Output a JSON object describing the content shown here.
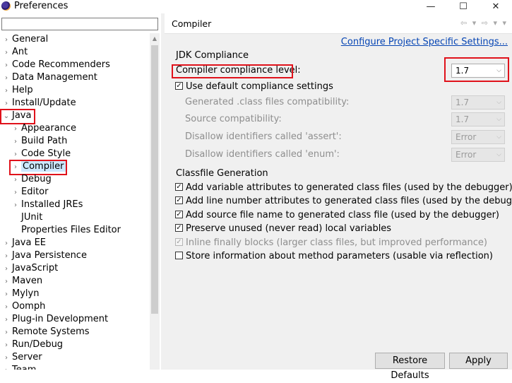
{
  "window": {
    "title": "Preferences",
    "minimize": "—",
    "maximize": "☐",
    "close": "✕"
  },
  "filter": {
    "placeholder": "",
    "value": ""
  },
  "tree": {
    "items": [
      {
        "label": "General",
        "expandable": true,
        "expanded": false,
        "depth": 0
      },
      {
        "label": "Ant",
        "expandable": true,
        "expanded": false,
        "depth": 0
      },
      {
        "label": "Code Recommenders",
        "expandable": true,
        "expanded": false,
        "depth": 0
      },
      {
        "label": "Data Management",
        "expandable": true,
        "expanded": false,
        "depth": 0
      },
      {
        "label": "Help",
        "expandable": true,
        "expanded": false,
        "depth": 0
      },
      {
        "label": "Install/Update",
        "expandable": true,
        "expanded": false,
        "depth": 0
      },
      {
        "label": "Java",
        "expandable": true,
        "expanded": true,
        "depth": 0,
        "highlighted": true
      },
      {
        "label": "Appearance",
        "expandable": true,
        "expanded": false,
        "depth": 1
      },
      {
        "label": "Build Path",
        "expandable": true,
        "expanded": false,
        "depth": 1
      },
      {
        "label": "Code Style",
        "expandable": true,
        "expanded": false,
        "depth": 1
      },
      {
        "label": "Compiler",
        "expandable": true,
        "expanded": false,
        "depth": 1,
        "selected": true,
        "highlighted": true
      },
      {
        "label": "Debug",
        "expandable": true,
        "expanded": false,
        "depth": 1
      },
      {
        "label": "Editor",
        "expandable": true,
        "expanded": false,
        "depth": 1
      },
      {
        "label": "Installed JREs",
        "expandable": true,
        "expanded": false,
        "depth": 1
      },
      {
        "label": "JUnit",
        "expandable": false,
        "expanded": false,
        "depth": 1
      },
      {
        "label": "Properties Files Editor",
        "expandable": false,
        "expanded": false,
        "depth": 1
      },
      {
        "label": "Java EE",
        "expandable": true,
        "expanded": false,
        "depth": 0
      },
      {
        "label": "Java Persistence",
        "expandable": true,
        "expanded": false,
        "depth": 0
      },
      {
        "label": "JavaScript",
        "expandable": true,
        "expanded": false,
        "depth": 0
      },
      {
        "label": "Maven",
        "expandable": true,
        "expanded": false,
        "depth": 0
      },
      {
        "label": "Mylyn",
        "expandable": true,
        "expanded": false,
        "depth": 0
      },
      {
        "label": "Oomph",
        "expandable": true,
        "expanded": false,
        "depth": 0
      },
      {
        "label": "Plug-in Development",
        "expandable": true,
        "expanded": false,
        "depth": 0
      },
      {
        "label": "Remote Systems",
        "expandable": true,
        "expanded": false,
        "depth": 0
      },
      {
        "label": "Run/Debug",
        "expandable": true,
        "expanded": false,
        "depth": 0
      },
      {
        "label": "Server",
        "expandable": true,
        "expanded": false,
        "depth": 0
      },
      {
        "label": "Team",
        "expandable": true,
        "expanded": false,
        "depth": 0
      }
    ]
  },
  "page": {
    "title": "Compiler",
    "nav_arrows": "⇦ ▾ ⇨ ▾ ▾",
    "config_link": "Configure Project Specific Settings...",
    "jdk_section": {
      "title": "JDK Compliance",
      "compliance_label": "Compiler compliance level:",
      "compliance_value": "1.7",
      "use_default_label": "Use default compliance settings",
      "use_default_checked": true,
      "rows": [
        {
          "label": "Generated .class files compatibility:",
          "value": "1.7"
        },
        {
          "label": "Source compatibility:",
          "value": "1.7"
        },
        {
          "label": "Disallow identifiers called 'assert':",
          "value": "Error"
        },
        {
          "label": "Disallow identifiers called 'enum':",
          "value": "Error"
        }
      ]
    },
    "classfile_section": {
      "title": "Classfile Generation",
      "options": [
        {
          "label": "Add variable attributes to generated class files (used by the debugger)",
          "checked": true,
          "enabled": true
        },
        {
          "label": "Add line number attributes to generated class files (used by the debugger)",
          "checked": true,
          "enabled": true
        },
        {
          "label": "Add source file name to generated class file (used by the debugger)",
          "checked": true,
          "enabled": true
        },
        {
          "label": "Preserve unused (never read) local variables",
          "checked": true,
          "enabled": true
        },
        {
          "label": "Inline finally blocks (larger class files, but improved performance)",
          "checked": true,
          "enabled": false
        },
        {
          "label": "Store information about method parameters (usable via reflection)",
          "checked": false,
          "enabled": true
        }
      ]
    },
    "buttons": {
      "restore_defaults": "Restore Defaults",
      "apply": "Apply"
    }
  },
  "colors": {
    "highlight_border": "#e0121b",
    "link": "#0645b4",
    "panel_bg": "#f0f0f0"
  }
}
